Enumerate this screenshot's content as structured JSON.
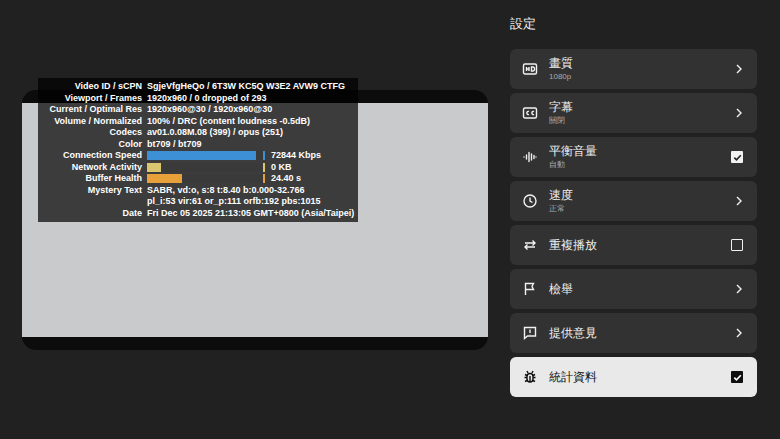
{
  "stats": {
    "rows": [
      {
        "label": "Video ID / sCPN",
        "kind": "text",
        "values": [
          "SgjeVfgHeQo / 6T3W KC5Q W3E2 AVW9 CTFG"
        ]
      },
      {
        "label": "Viewport / Frames",
        "kind": "text",
        "values": [
          "1920x960 / 0 dropped of 293"
        ]
      },
      {
        "label": "Current / Optimal Res",
        "kind": "text",
        "values": [
          "1920x960@30 / 1920x960@30"
        ]
      },
      {
        "label": "Volume / Normalized",
        "kind": "text",
        "values": [
          "100% / DRC (content loudness -0.5dB)"
        ]
      },
      {
        "label": "Codecs",
        "kind": "text",
        "values": [
          "av01.0.08M.08 (399) / opus (251)"
        ]
      },
      {
        "label": "Color",
        "kind": "text",
        "values": [
          "bt709 / bt709"
        ]
      },
      {
        "label": "Connection Speed",
        "kind": "graph",
        "level": 0.92,
        "color": "#3d8fd6",
        "values": [
          "72844 Kbps"
        ]
      },
      {
        "label": "Network Activity",
        "kind": "graph",
        "level": 0.12,
        "color": "#d9c66e",
        "values": [
          "0 KB"
        ]
      },
      {
        "label": "Buffer Health",
        "kind": "graph",
        "level": 0.3,
        "color": "#e8a03a",
        "values": [
          "24.40 s"
        ]
      },
      {
        "label": "Mystery Text",
        "kind": "text",
        "values": [
          "SABR, vd:o, s:8 t:8.40 b:0.000-32.766",
          "pl_i:53 vir:61 or_p:111 orfb:192 pbs:1015"
        ]
      },
      {
        "label": "Date",
        "kind": "text",
        "values": [
          "Fri Dec 05 2025 21:13:05 GMT+0800 (Asia/Taipei)"
        ]
      }
    ]
  },
  "settings": {
    "title": "設定",
    "items": [
      {
        "label": "畫質",
        "value": "1080p",
        "kind": "link",
        "selected": false
      },
      {
        "label": "字幕",
        "value": "關閉",
        "kind": "link",
        "selected": false
      },
      {
        "label": "平衡音量",
        "value": "自動",
        "kind": "toggle",
        "checked": true,
        "selected": false
      },
      {
        "label": "速度",
        "value": "正常",
        "kind": "link",
        "selected": false
      },
      {
        "label": "重複播放",
        "kind": "toggle",
        "checked": false,
        "selected": false
      },
      {
        "label": "檢舉",
        "kind": "link",
        "selected": false
      },
      {
        "label": "提供意見",
        "kind": "link",
        "selected": false
      },
      {
        "label": "統計資料",
        "kind": "toggle",
        "checked": true,
        "selected": true
      }
    ]
  }
}
